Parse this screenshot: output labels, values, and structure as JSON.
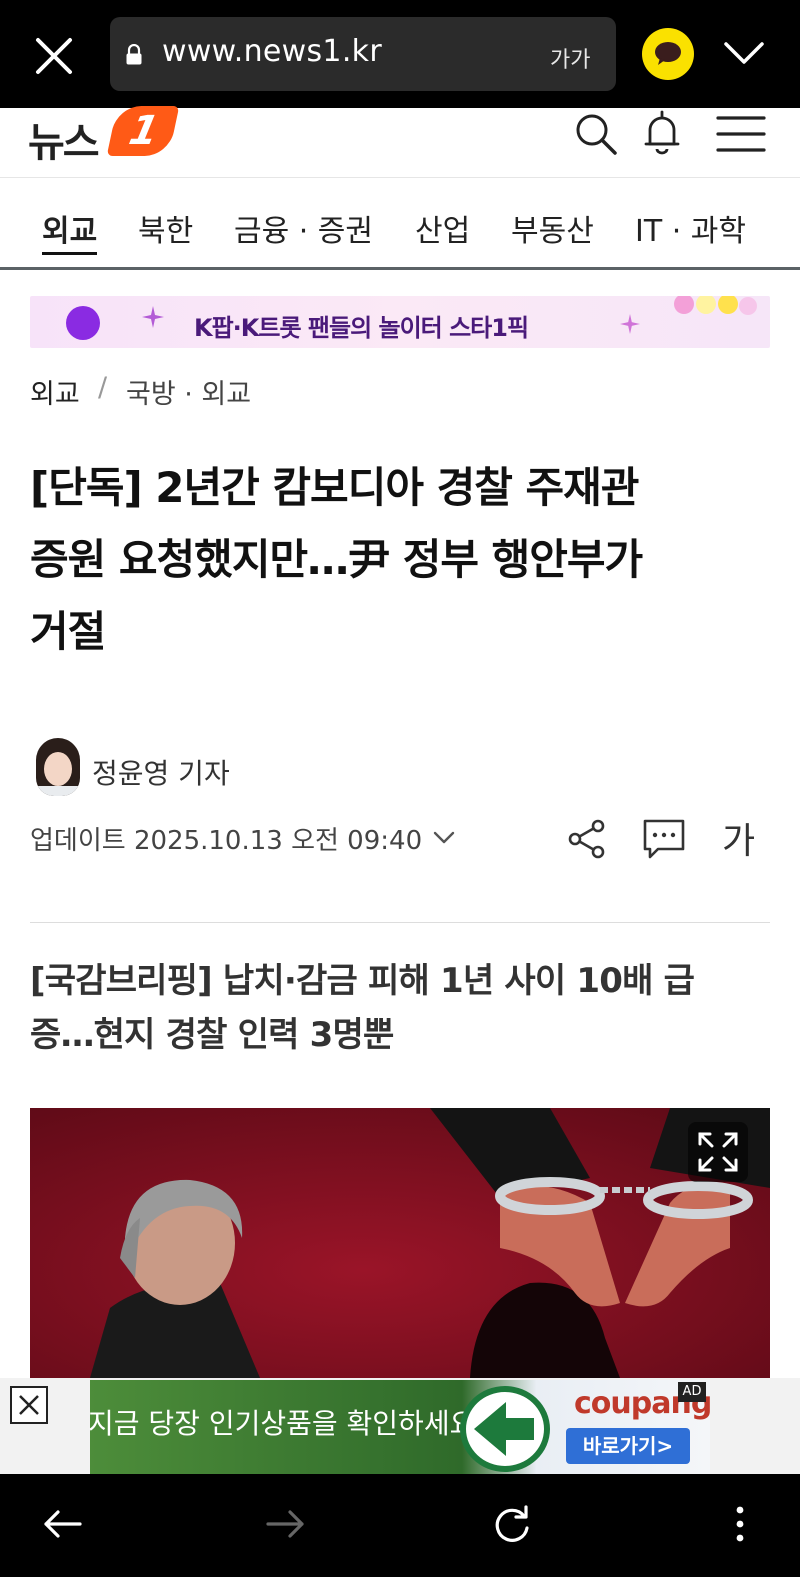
{
  "browser": {
    "url": "www.news1.kr",
    "font_size_label": "가가",
    "accent": "#fae100"
  },
  "site": {
    "logo_text": "뉴스",
    "logo_mark": "1",
    "brand_color": "#ff5a16",
    "icons": [
      "search-icon",
      "bell-icon",
      "menu-icon"
    ]
  },
  "categories": [
    {
      "label": "외교",
      "active": true
    },
    {
      "label": "북한",
      "active": false
    },
    {
      "label": "금융 · 증권",
      "active": false
    },
    {
      "label": "산업",
      "active": false
    },
    {
      "label": "부동산",
      "active": false
    },
    {
      "label": "IT · 과학",
      "active": false
    }
  ],
  "banner": {
    "text": "K팝·K트롯 팬들의 놀이터 스타1픽"
  },
  "breadcrumb": {
    "section": "외교",
    "separator": "/",
    "subsection": "국방 · 외교"
  },
  "article": {
    "headline_lines": [
      "[단독] 2년간 캄보디아 경찰 주재관",
      "증원 요청했지만…尹 정부 행안부가",
      "거절"
    ],
    "reporter": "정윤영 기자",
    "updated": "업데이트 2025.10.13 오전 09:40",
    "font_size_button": "가",
    "subheading_lines": [
      "[국감브리핑] 납치·감금 피해 1년 사이 10배 급",
      "증…현지 경찰 인력 3명뿐"
    ]
  },
  "ad": {
    "text": "지금 당장 인기상품을 확인하세요!",
    "brand": "coupang",
    "button": "바로가기>",
    "tag": "AD"
  }
}
